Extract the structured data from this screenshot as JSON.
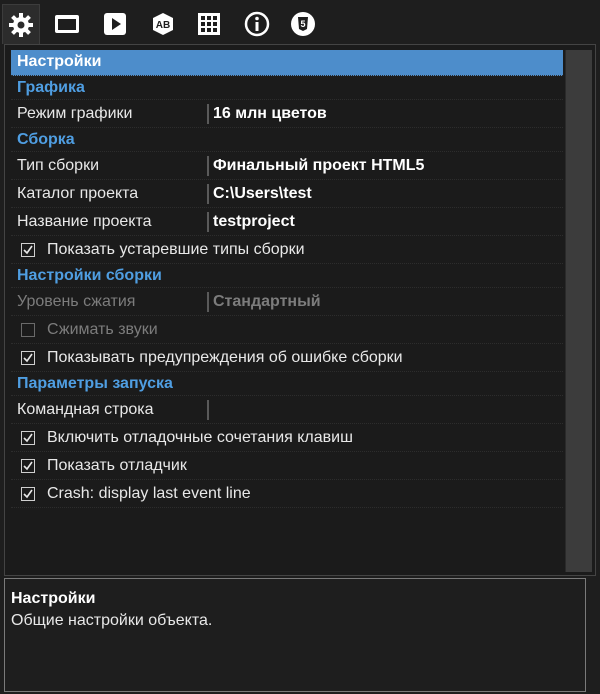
{
  "toolbar": {
    "tabs": [
      {
        "icon": "gear-icon",
        "active": true
      },
      {
        "icon": "window-icon",
        "active": false
      },
      {
        "icon": "play-icon",
        "active": false
      },
      {
        "icon": "ab-icon",
        "active": false
      },
      {
        "icon": "grid-icon",
        "active": false
      },
      {
        "icon": "info-icon",
        "active": false
      },
      {
        "icon": "html5-icon",
        "active": false
      }
    ]
  },
  "grid": {
    "header": "Настройки",
    "cat_graphics": "Графика",
    "graphics_mode_label": "Режим графики",
    "graphics_mode_value": "16 млн цветов",
    "cat_build": "Сборка",
    "build_type_label": "Тип сборки",
    "build_type_value": "Финальный проект HTML5",
    "project_dir_label": "Каталог проекта",
    "project_dir_value": "C:\\Users\\test",
    "project_name_label": "Название проекта",
    "project_name_value": "testproject",
    "show_old_types_label": "Показать устаревшие типы сборки",
    "show_old_types_checked": true,
    "cat_build_settings": "Настройки сборки",
    "compression_label": "Уровень сжатия",
    "compression_value": "Стандартный",
    "compress_sounds_label": "Сжимать звуки",
    "compress_sounds_checked": false,
    "show_build_warnings_label": "Показывать предупреждения об ошибке сборки",
    "show_build_warnings_checked": true,
    "cat_run_params": "Параметры запуска",
    "command_line_label": "Командная строка",
    "command_line_value": "",
    "debug_shortcuts_label": "Включить отладочные сочетания клавиш",
    "debug_shortcuts_checked": true,
    "show_debugger_label": "Показать отладчик",
    "show_debugger_checked": true,
    "crash_event_label": "Crash: display last event line",
    "crash_event_checked": true
  },
  "description": {
    "title": "Настройки",
    "text": "Общие настройки объекта."
  },
  "colors": {
    "accent_header": "#4d8dcb",
    "category_text": "#4f9ee2",
    "background": "#1e1e1e"
  }
}
